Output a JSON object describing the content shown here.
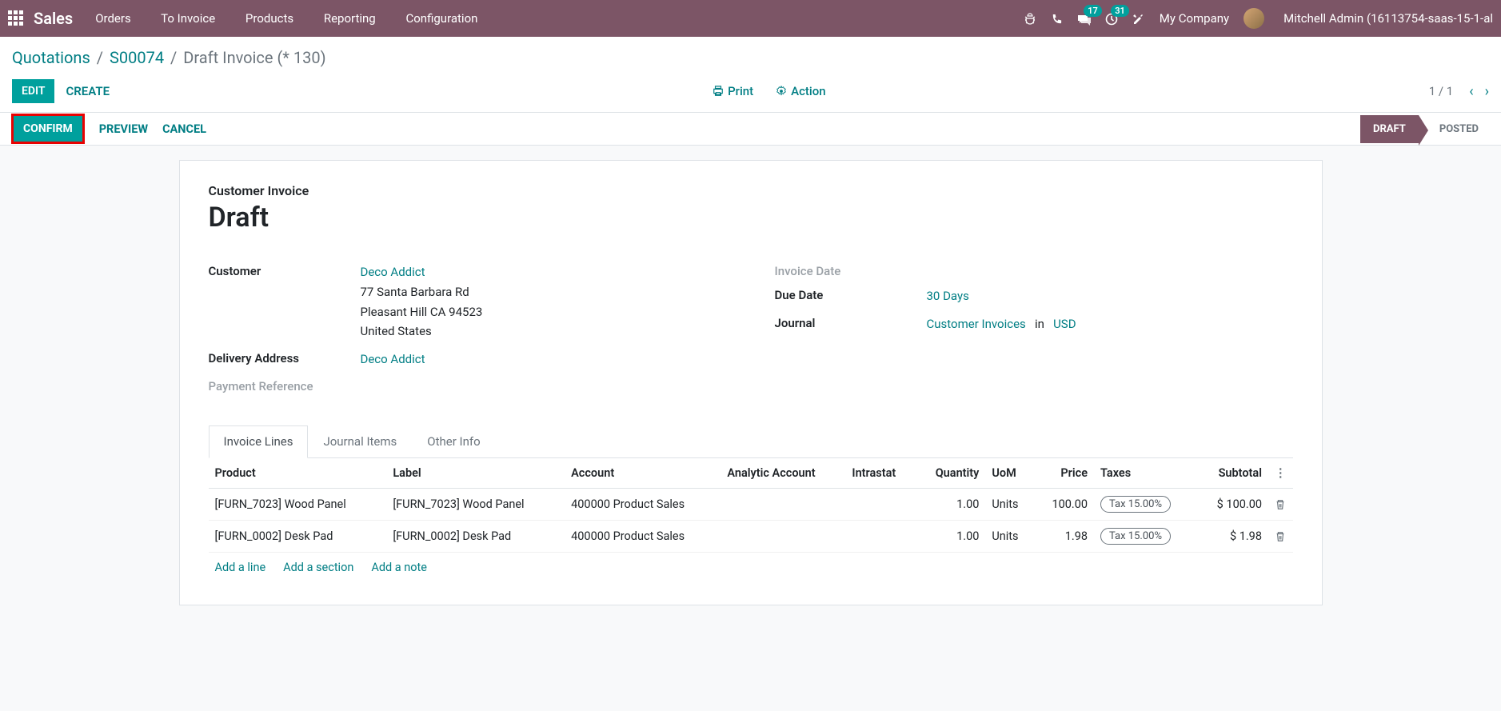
{
  "topbar": {
    "brand": "Sales",
    "nav": [
      "Orders",
      "To Invoice",
      "Products",
      "Reporting",
      "Configuration"
    ],
    "msg_badge": "17",
    "activity_badge": "31",
    "company": "My Company",
    "user": "Mitchell Admin (16113754-saas-15-1-al"
  },
  "breadcrumb": {
    "items": [
      "Quotations",
      "S00074"
    ],
    "current": "Draft Invoice (* 130)"
  },
  "controls": {
    "edit": "EDIT",
    "create": "CREATE",
    "print": "Print",
    "action": "Action",
    "pager": "1 / 1"
  },
  "statusbar": {
    "confirm": "CONFIRM",
    "preview": "PREVIEW",
    "cancel": "CANCEL",
    "draft": "DRAFT",
    "posted": "POSTED"
  },
  "doc": {
    "type": "Customer Invoice",
    "title": "Draft",
    "customer_label": "Customer",
    "customer_name": "Deco Addict",
    "addr1": "77 Santa Barbara Rd",
    "addr2": "Pleasant Hill CA 94523",
    "addr3": "United States",
    "delivery_label": "Delivery Address",
    "delivery_value": "Deco Addict",
    "payref_label": "Payment Reference",
    "invoice_date_label": "Invoice Date",
    "due_date_label": "Due Date",
    "due_date_value": "30 Days",
    "journal_label": "Journal",
    "journal_value": "Customer Invoices",
    "journal_in": "in",
    "journal_currency": "USD"
  },
  "tabs": [
    "Invoice Lines",
    "Journal Items",
    "Other Info"
  ],
  "table": {
    "headers": {
      "product": "Product",
      "label": "Label",
      "account": "Account",
      "analytic": "Analytic Account",
      "intrastat": "Intrastat",
      "quantity": "Quantity",
      "uom": "UoM",
      "price": "Price",
      "taxes": "Taxes",
      "subtotal": "Subtotal"
    },
    "rows": [
      {
        "product": "[FURN_7023] Wood Panel",
        "label": "[FURN_7023] Wood Panel",
        "account": "400000 Product Sales",
        "analytic": "",
        "intrastat": "",
        "qty": "1.00",
        "uom": "Units",
        "price": "100.00",
        "tax": "Tax 15.00%",
        "subtotal": "$ 100.00"
      },
      {
        "product": "[FURN_0002] Desk Pad",
        "label": "[FURN_0002] Desk Pad",
        "account": "400000 Product Sales",
        "analytic": "",
        "intrastat": "",
        "qty": "1.00",
        "uom": "Units",
        "price": "1.98",
        "tax": "Tax 15.00%",
        "subtotal": "$ 1.98"
      }
    ],
    "add_line": "Add a line",
    "add_section": "Add a section",
    "add_note": "Add a note"
  }
}
